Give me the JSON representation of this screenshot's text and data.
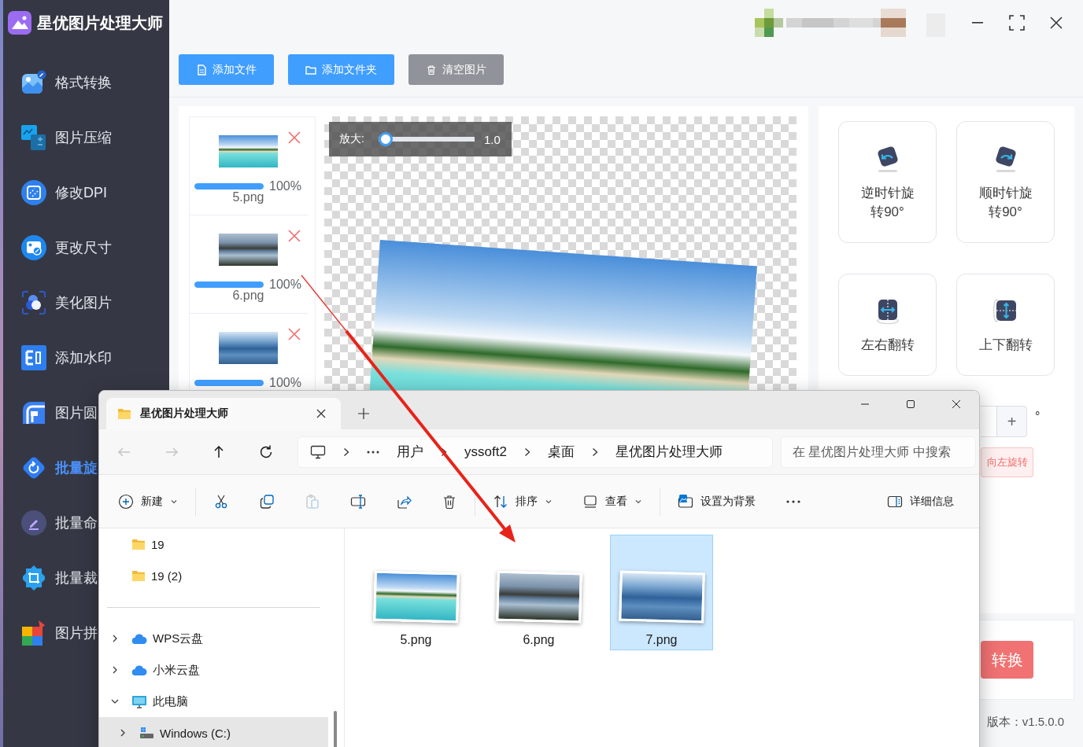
{
  "app": {
    "title": "星优图片处理大师"
  },
  "sidebar": {
    "items": [
      {
        "label": "格式转换",
        "selected": false
      },
      {
        "label": "图片压缩",
        "selected": false
      },
      {
        "label": "修改DPI",
        "selected": false
      },
      {
        "label": "更改尺寸",
        "selected": false
      },
      {
        "label": "美化图片",
        "selected": false
      },
      {
        "label": "添加水印",
        "selected": false
      },
      {
        "label": "图片圆",
        "selected": false
      },
      {
        "label": "批量旋",
        "selected": true
      },
      {
        "label": "批量命",
        "selected": false
      },
      {
        "label": "批量裁",
        "selected": false
      },
      {
        "label": "图片拼",
        "selected": false
      }
    ]
  },
  "toolbar": {
    "buttons": [
      {
        "label": "添加文件",
        "kind": "primary"
      },
      {
        "label": "添加文件夹",
        "kind": "primary"
      },
      {
        "label": "清空图片",
        "kind": "secondary"
      }
    ]
  },
  "file_list": [
    {
      "name": "5.png",
      "progress": "100%",
      "level": 1
    },
    {
      "name": "6.png",
      "progress": "100%",
      "level": 1
    },
    {
      "progress": "100%",
      "level": 1
    }
  ],
  "preview": {
    "zoom": {
      "label": "放大:",
      "value": "1.0",
      "level": 0
    }
  },
  "transform_actions": [
    {
      "label": "逆时针旋转90°"
    },
    {
      "label": "顺时针旋转90°"
    },
    {
      "label": "左右翻转"
    },
    {
      "label": "上下翻转"
    }
  ],
  "rotation": {
    "increment": "+",
    "unit": "°",
    "rotate_button": "向左旋转"
  },
  "start_button": {
    "label": "转换"
  },
  "version": "版本：v1.5.0.0",
  "explorer": {
    "tab": {
      "title": "星优图片处理大师"
    },
    "nav_buttons": [
      {
        "kind": "back",
        "disabled": true
      },
      {
        "kind": "forward",
        "disabled": true
      },
      {
        "kind": "up",
        "disabled": false
      },
      {
        "kind": "refresh",
        "disabled": false
      }
    ],
    "breadcrumb": [
      "用户",
      "yssoft2",
      "桌面",
      "星优图片处理大师"
    ],
    "search": {
      "placeholder": "在 星优图片处理大师 中搜索"
    },
    "command_groups": [
      [
        {
          "kind": "new",
          "label": "新建",
          "dropdown": true,
          "disabled": false
        }
      ],
      [
        {
          "kind": "cut",
          "dropdown": false,
          "disabled": false
        },
        {
          "kind": "copy",
          "dropdown": false,
          "disabled": false
        },
        {
          "kind": "paste",
          "dropdown": false,
          "disabled": true
        },
        {
          "kind": "rename",
          "dropdown": false,
          "disabled": false
        },
        {
          "kind": "share",
          "dropdown": false,
          "disabled": false
        },
        {
          "kind": "delete",
          "dropdown": false,
          "disabled": false
        }
      ],
      [
        {
          "kind": "sort",
          "label": "排序",
          "dropdown": true,
          "disabled": false
        },
        {
          "kind": "view",
          "label": "查看",
          "dropdown": true,
          "disabled": false
        }
      ],
      [
        {
          "kind": "background",
          "label": "设置为背景",
          "dropdown": false,
          "disabled": false
        },
        {
          "kind": "more",
          "dropdown": false,
          "disabled": false
        }
      ]
    ],
    "details_button": {
      "label": "详细信息"
    },
    "nav": {
      "pinned": [
        {
          "label": "19",
          "kind": "folder",
          "selected": false
        },
        {
          "label": "19 (2)",
          "kind": "folder",
          "selected": false
        }
      ],
      "tree": [
        {
          "label": "WPS云盘",
          "kind": "cloud",
          "expanded": false,
          "selected": false
        },
        {
          "label": "小米云盘",
          "kind": "cloud",
          "expanded": false,
          "selected": false
        },
        {
          "label": "此电脑",
          "kind": "computer",
          "expanded": true,
          "selected": false,
          "children": [
            {
              "label": "Windows (C:)",
              "kind": "drive",
              "expanded": false,
              "selected": true
            }
          ]
        }
      ]
    },
    "files": [
      {
        "name": "5.png",
        "selected": false
      },
      {
        "name": "6.png",
        "selected": false
      },
      {
        "name": "7.png",
        "selected": true
      }
    ]
  }
}
